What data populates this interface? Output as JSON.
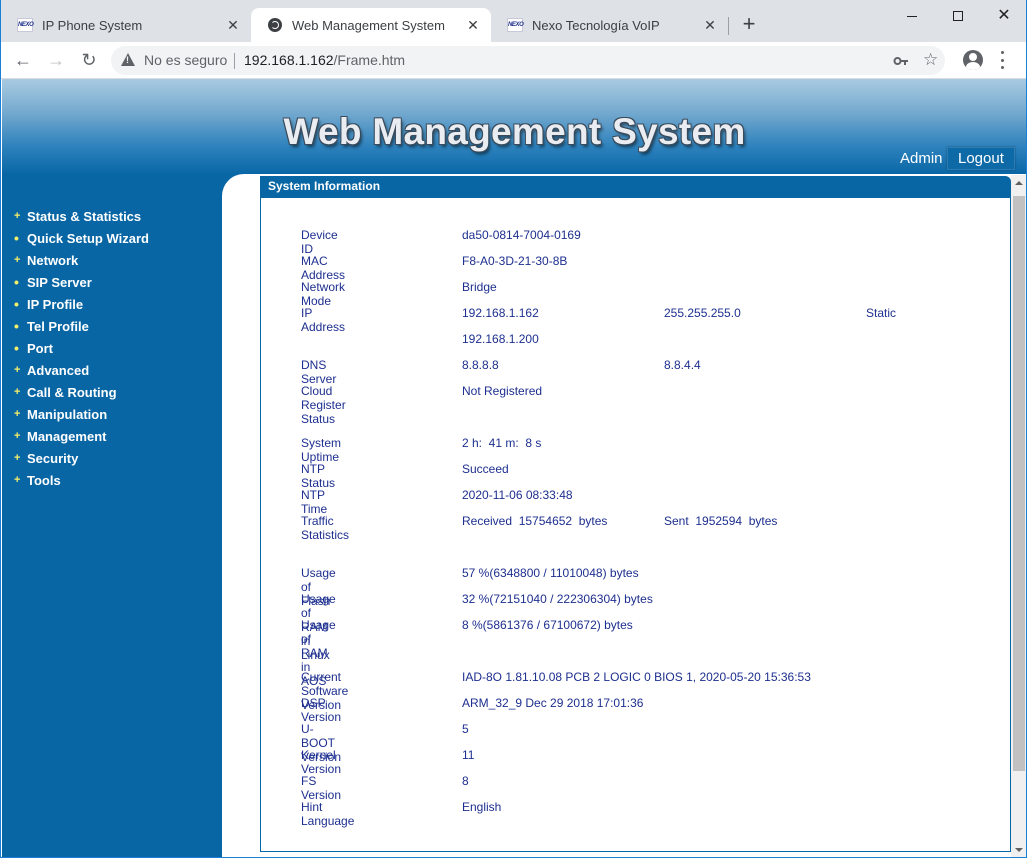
{
  "browser": {
    "tabs": [
      {
        "label": "IP Phone System",
        "icon": "nexo-logo-icon",
        "active": false
      },
      {
        "label": "Web Management System",
        "icon": "globe-icon",
        "active": true
      },
      {
        "label": "Nexo Tecnología VoIP",
        "icon": "nexo-logo-icon",
        "active": false
      }
    ],
    "new_tab": "+",
    "security_label": "No es seguro",
    "url_host": "192.168.1.162",
    "url_path": "/Frame.htm",
    "icons": {
      "back": "←",
      "forward": "→",
      "reload": "↻",
      "star": "☆",
      "close": "✕"
    }
  },
  "header": {
    "title": "Web Management System",
    "user": "Admin",
    "logout_label": "Logout"
  },
  "sidebar": {
    "items": [
      {
        "label": "Status & Statistics",
        "bullet": "+"
      },
      {
        "label": "Quick Setup Wizard",
        "bullet": "•"
      },
      {
        "label": "Network",
        "bullet": "+"
      },
      {
        "label": "SIP Server",
        "bullet": "•"
      },
      {
        "label": "IP Profile",
        "bullet": "•"
      },
      {
        "label": "Tel Profile",
        "bullet": "•"
      },
      {
        "label": "Port",
        "bullet": "•"
      },
      {
        "label": "Advanced",
        "bullet": "+"
      },
      {
        "label": "Call & Routing",
        "bullet": "+"
      },
      {
        "label": "Manipulation",
        "bullet": "+"
      },
      {
        "label": "Management",
        "bullet": "+"
      },
      {
        "label": "Security",
        "bullet": "+"
      },
      {
        "label": "Tools",
        "bullet": "+"
      }
    ]
  },
  "panel": {
    "title": "System Information",
    "device_id": {
      "label": "Device ID",
      "value": "da50-0814-7004-0169"
    },
    "mac": {
      "label": "MAC Address",
      "value": "F8-A0-3D-21-30-8B"
    },
    "network_mode": {
      "label": "Network Mode",
      "value": "Bridge"
    },
    "ip": {
      "label": "IP Address",
      "address": "192.168.1.162",
      "mask": "255.255.255.0",
      "type": "Static",
      "gateway": "192.168.1.200"
    },
    "dns": {
      "label": "DNS Server",
      "primary": "8.8.8.8",
      "secondary": "8.8.4.4"
    },
    "cloud": {
      "label": "Cloud Register Status",
      "value": "Not Registered"
    },
    "uptime": {
      "label": "System Uptime",
      "value": "2 h:  41 m:  8 s"
    },
    "ntp_status": {
      "label": "NTP Status",
      "value": "Succeed"
    },
    "ntp_time": {
      "label": "NTP Time",
      "value": "2020-11-06 08:33:48"
    },
    "traffic": {
      "label": "Traffic Statistics",
      "received": "Received  15754652  bytes",
      "sent": "Sent  1952594  bytes"
    },
    "flash": {
      "label": "Usage of Flash",
      "value": "57 %(6348800 / 11010048) bytes"
    },
    "ram_linux": {
      "label": "Usage of RAM in Linux",
      "value": "32 %(72151040 / 222306304) bytes"
    },
    "ram_aos": {
      "label": "Usage of RAM in AOS",
      "value": "8 %(5861376 / 67100672) bytes"
    },
    "software": {
      "label": "Current Software Version",
      "value": "IAD-8O 1.81.10.08 PCB 2 LOGIC 0 BIOS 1, 2020-05-20 15:36:53"
    },
    "dsp": {
      "label": "DSP Version",
      "value": "ARM_32_9 Dec 29 2018 17:01:36"
    },
    "uboot": {
      "label": "U-BOOT Version",
      "value": "5"
    },
    "kernel": {
      "label": "Kernel Version",
      "value": "11"
    },
    "fs": {
      "label": "FS Version",
      "value": "8"
    },
    "hint_language": {
      "label": "Hint Language",
      "value": "English"
    }
  },
  "colors": {
    "brand_blue": "#0866a5",
    "text_blue": "#1d2f8f",
    "bullet_yellow": "#f7f06a"
  }
}
